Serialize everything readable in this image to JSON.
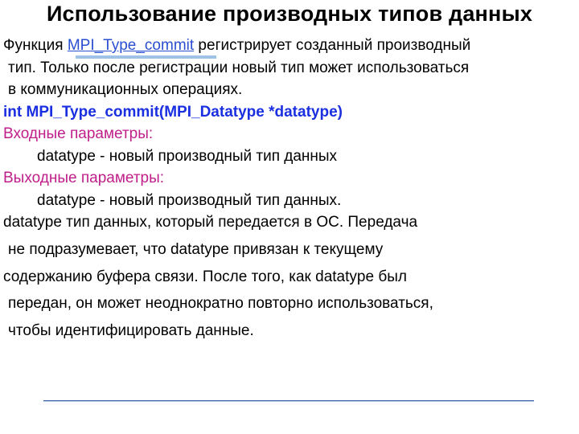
{
  "title": "Использование производных типов данных",
  "intro_pre": "Функция ",
  "intro_link": "MPI_Type_commit",
  "intro_post": " регистрирует созданный производный",
  "intro_l2": " тип. Только после регистрации новый тип может использоваться",
  "intro_l3": " в коммуникационных операциях.",
  "proto": "int MPI_Type_commit(MPI_Datatype *datatype)",
  "in_label": "Входные параметры:",
  "in_param": "datatype  - новый производный тип данных",
  "out_label": "Выходные параметры:",
  "out_param": "datatype  - новый производный тип данных.",
  "desc_l1": "datatype   тип данных, который передается  в ОС. Передача",
  "desc_l2": " не подразумевает, что datatype привязан к текущему",
  "desc_l3": "содержанию буфера связи. После того, как datatype был",
  "desc_l4": " передан, он может неоднократно повторно использоваться,",
  "desc_l5": " чтобы идентифицировать данные."
}
